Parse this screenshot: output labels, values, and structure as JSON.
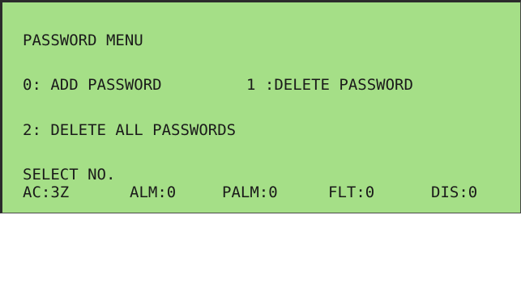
{
  "menu": {
    "title": "PASSWORD MENU",
    "option_0": "0: ADD PASSWORD",
    "option_1": "1 :DELETE PASSWORD",
    "option_2": "2: DELETE ALL PASSWORDS",
    "prompt": "SELECT NO."
  },
  "status": {
    "ac": "AC:3Z",
    "alm": "ALM:0",
    "palm": "PALM:0",
    "flt": "FLT:0",
    "dis": "DIS:0"
  },
  "colors": {
    "screen_background": "#a5df87",
    "text": "#1a1a1a"
  }
}
